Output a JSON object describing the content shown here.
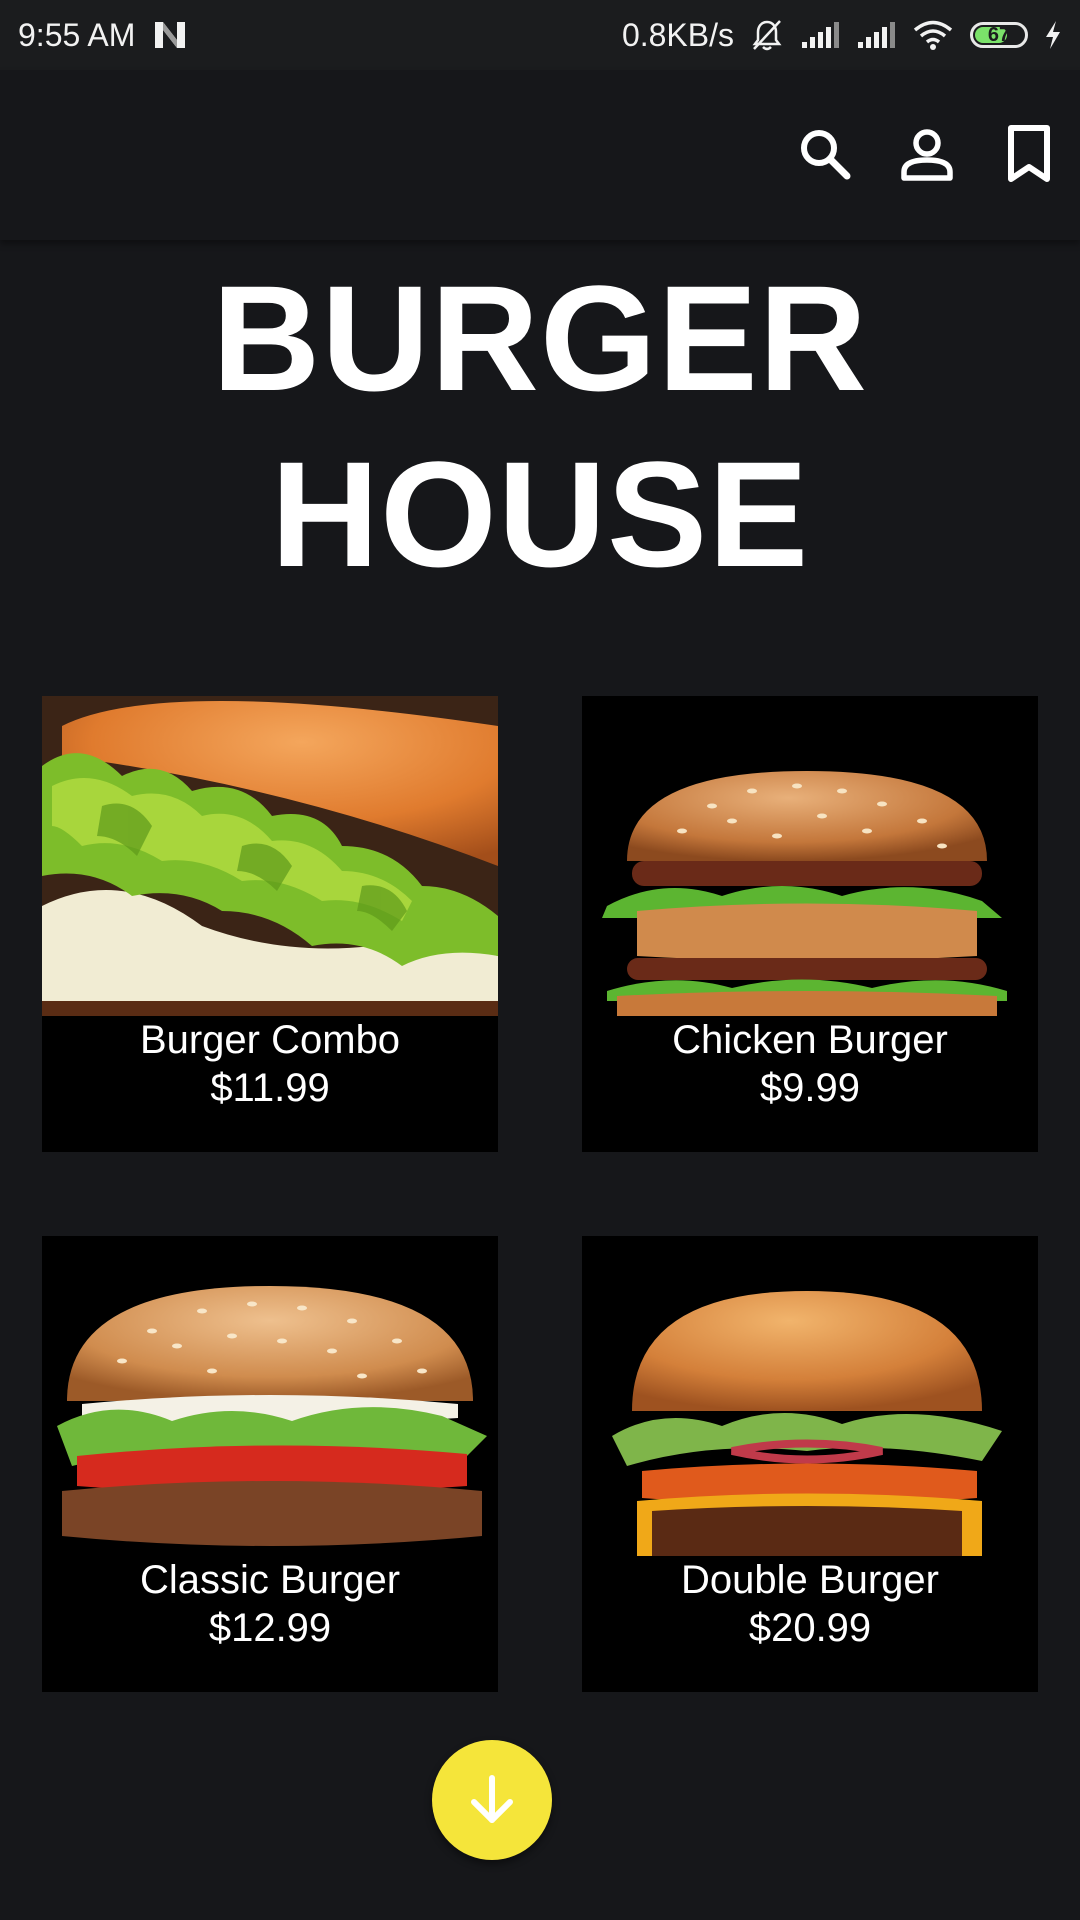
{
  "status_bar": {
    "time": "9:55 AM",
    "network_speed": "0.8KB/s",
    "battery_level": "67",
    "battery_fraction": 0.67,
    "icons": [
      "n-app-icon",
      "mute-bell-icon",
      "signal-icon",
      "signal-icon",
      "wifi-icon",
      "battery-icon",
      "charging-icon"
    ]
  },
  "app_bar": {
    "actions": [
      "search-icon",
      "account-icon",
      "bookmark-icon"
    ]
  },
  "title": {
    "line1": "BURGER",
    "line2": "HOUSE"
  },
  "menu": {
    "items": [
      {
        "name": "Burger Combo",
        "price": "$11.99"
      },
      {
        "name": "Chicken Burger",
        "price": "$9.99"
      },
      {
        "name": "Classic Burger",
        "price": "$12.99"
      },
      {
        "name": "Double Burger",
        "price": "$20.99"
      }
    ]
  },
  "fab": {
    "icon": "arrow-down-icon"
  },
  "colors": {
    "background": "#16171a",
    "card": "#000000",
    "fab": "#f5e53a",
    "text": "#ffffff"
  }
}
